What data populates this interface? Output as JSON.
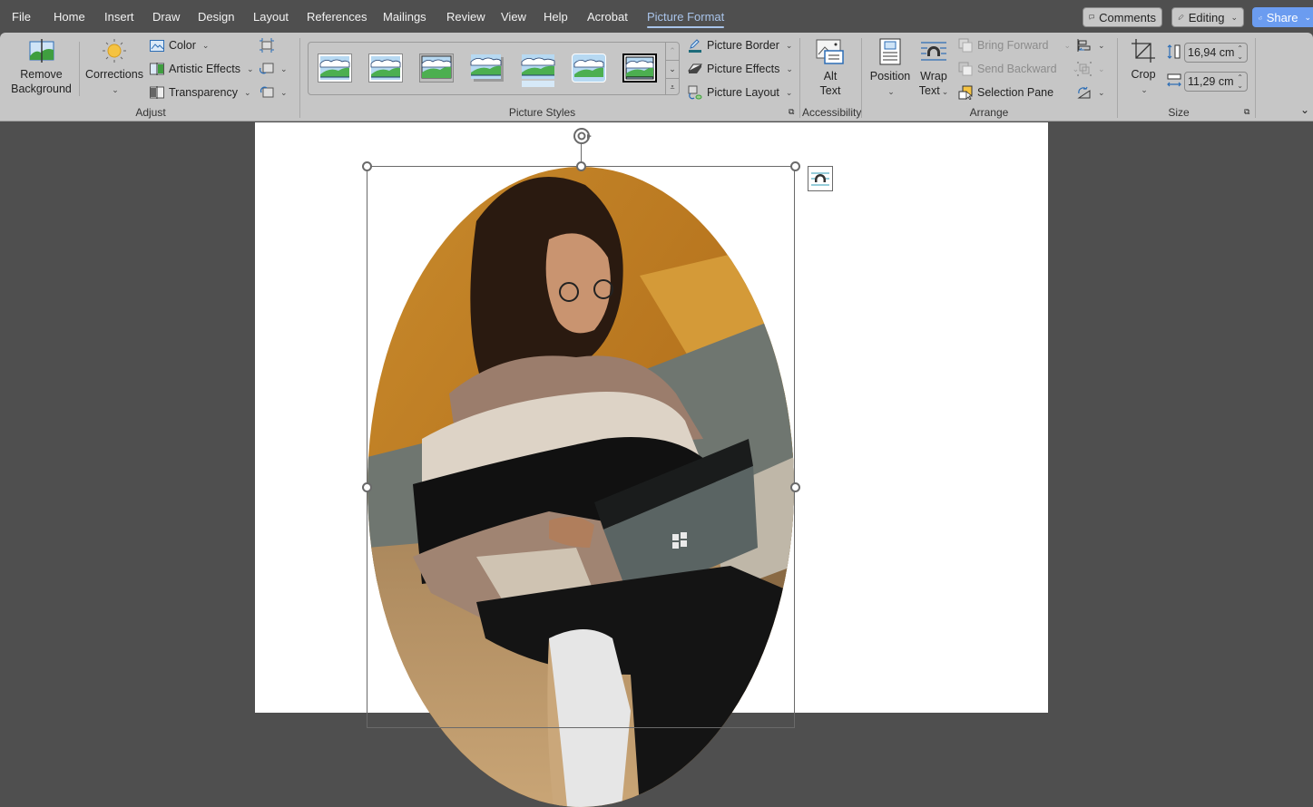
{
  "menubar": {
    "tabs": [
      {
        "label": "File"
      },
      {
        "label": "Home"
      },
      {
        "label": "Insert"
      },
      {
        "label": "Draw"
      },
      {
        "label": "Design"
      },
      {
        "label": "Layout"
      },
      {
        "label": "References"
      },
      {
        "label": "Mailings"
      },
      {
        "label": "Review"
      },
      {
        "label": "View"
      },
      {
        "label": "Help"
      },
      {
        "label": "Acrobat"
      },
      {
        "label": "Picture Format",
        "active": true
      }
    ],
    "comments_label": "Comments",
    "editing_label": "Editing",
    "share_label": "Share"
  },
  "ribbon": {
    "adjust": {
      "group_label": "Adjust",
      "remove_background": {
        "line1": "Remove",
        "line2": "Background"
      },
      "corrections_label": "Corrections",
      "color_label": "Color",
      "artistic_effects_label": "Artistic Effects",
      "transparency_label": "Transparency"
    },
    "picture_styles": {
      "group_label": "Picture Styles",
      "picture_border_label": "Picture Border",
      "picture_effects_label": "Picture Effects",
      "picture_layout_label": "Picture Layout"
    },
    "accessibility": {
      "group_label": "Accessibility",
      "alt_text": {
        "line1": "Alt",
        "line2": "Text"
      }
    },
    "arrange": {
      "group_label": "Arrange",
      "position_label": "Position",
      "wrap_text": {
        "line1": "Wrap",
        "line2": "Text"
      },
      "bring_forward_label": "Bring Forward",
      "send_backward_label": "Send Backward",
      "selection_pane_label": "Selection Pane"
    },
    "size": {
      "group_label": "Size",
      "crop_label": "Crop",
      "height_value": "16,94 cm",
      "width_value": "11,29 cm"
    }
  },
  "colors": {
    "accent_tab": "#a9c4ea",
    "share_button": "#6b9cf0",
    "ribbon_bg": "#c6c6c6",
    "app_bg": "#4f4f4f"
  }
}
